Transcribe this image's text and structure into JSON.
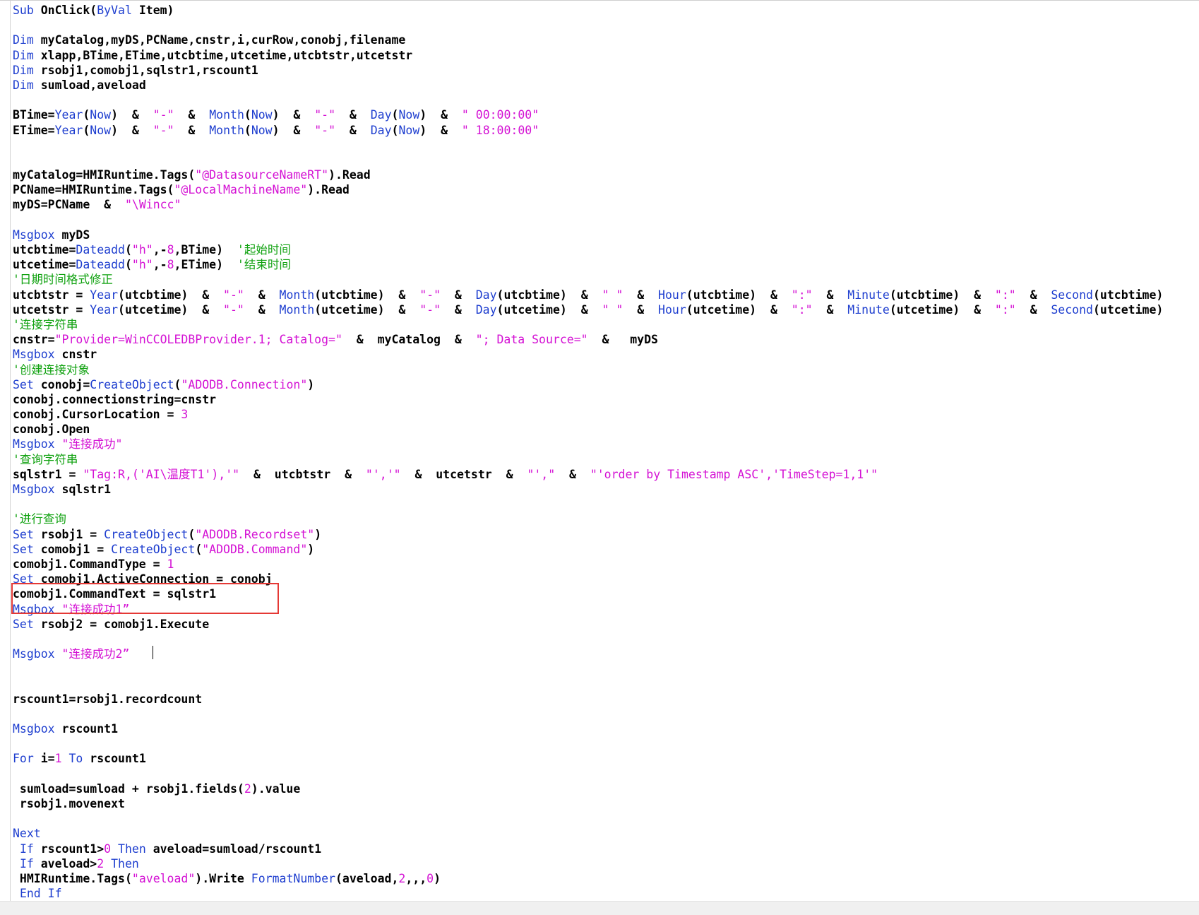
{
  "editor": {
    "lines": [
      [
        [
          "kw",
          "Sub"
        ],
        [
          "p",
          " OnClick("
        ],
        [
          "kw",
          "ByVal"
        ],
        [
          "p",
          " Item)"
        ]
      ],
      [],
      [
        [
          "kw",
          "Dim"
        ],
        [
          "p",
          " myCatalog,myDS,PCName,cnstr,i,curRow,conobj,filename"
        ]
      ],
      [
        [
          "kw",
          "Dim"
        ],
        [
          "p",
          " xlapp,BTime,ETime,utcbtime,utcetime,utcbtstr,utcetstr"
        ]
      ],
      [
        [
          "kw",
          "Dim"
        ],
        [
          "p",
          " rsobj1,comobj1,sqlstr1,rscount1"
        ]
      ],
      [
        [
          "kw",
          "Dim"
        ],
        [
          "p",
          " sumload,aveload"
        ]
      ],
      [],
      [
        [
          "p",
          "BTime="
        ],
        [
          "fn",
          "Year"
        ],
        [
          "p",
          "("
        ],
        [
          "fn",
          "Now"
        ],
        [
          "p",
          ")  &  "
        ],
        [
          "str",
          "\"-\""
        ],
        [
          "p",
          "  &  "
        ],
        [
          "fn",
          "Month"
        ],
        [
          "p",
          "("
        ],
        [
          "fn",
          "Now"
        ],
        [
          "p",
          ")  &  "
        ],
        [
          "str",
          "\"-\""
        ],
        [
          "p",
          "  &  "
        ],
        [
          "fn",
          "Day"
        ],
        [
          "p",
          "("
        ],
        [
          "fn",
          "Now"
        ],
        [
          "p",
          ")  &  "
        ],
        [
          "str",
          "\" 00:00:00\""
        ]
      ],
      [
        [
          "p",
          "ETime="
        ],
        [
          "fn",
          "Year"
        ],
        [
          "p",
          "("
        ],
        [
          "fn",
          "Now"
        ],
        [
          "p",
          ")  &  "
        ],
        [
          "str",
          "\"-\""
        ],
        [
          "p",
          "  &  "
        ],
        [
          "fn",
          "Month"
        ],
        [
          "p",
          "("
        ],
        [
          "fn",
          "Now"
        ],
        [
          "p",
          ")  &  "
        ],
        [
          "str",
          "\"-\""
        ],
        [
          "p",
          "  &  "
        ],
        [
          "fn",
          "Day"
        ],
        [
          "p",
          "("
        ],
        [
          "fn",
          "Now"
        ],
        [
          "p",
          ")  &  "
        ],
        [
          "str",
          "\" 18:00:00\""
        ]
      ],
      [],
      [],
      [
        [
          "p",
          "myCatalog=HMIRuntime.Tags("
        ],
        [
          "str",
          "\"@DatasourceNameRT\""
        ],
        [
          "p",
          ").Read"
        ]
      ],
      [
        [
          "p",
          "PCName=HMIRuntime.Tags("
        ],
        [
          "str",
          "\"@LocalMachineName\""
        ],
        [
          "p",
          ").Read"
        ]
      ],
      [
        [
          "p",
          "myDS=PCName  &  "
        ],
        [
          "str",
          "\"\\Wincc\""
        ]
      ],
      [],
      [
        [
          "kw",
          "Msgbox"
        ],
        [
          "p",
          " myDS"
        ]
      ],
      [
        [
          "p",
          "utcbtime="
        ],
        [
          "fn",
          "Dateadd"
        ],
        [
          "p",
          "("
        ],
        [
          "str",
          "\"h\""
        ],
        [
          "p",
          ",-"
        ],
        [
          "num",
          "8"
        ],
        [
          "p",
          ",BTime)  "
        ],
        [
          "cmt",
          "'起始时间"
        ]
      ],
      [
        [
          "p",
          "utcetime="
        ],
        [
          "fn",
          "Dateadd"
        ],
        [
          "p",
          "("
        ],
        [
          "str",
          "\"h\""
        ],
        [
          "p",
          ",-"
        ],
        [
          "num",
          "8"
        ],
        [
          "p",
          ",ETime)  "
        ],
        [
          "cmt",
          "'结束时间"
        ]
      ],
      [
        [
          "cmt",
          "'日期时间格式修正"
        ]
      ],
      [
        [
          "p",
          "utcbtstr = "
        ],
        [
          "fn",
          "Year"
        ],
        [
          "p",
          "(utcbtime)  &  "
        ],
        [
          "str",
          "\"-\""
        ],
        [
          "p",
          "  &  "
        ],
        [
          "fn",
          "Month"
        ],
        [
          "p",
          "(utcbtime)  &  "
        ],
        [
          "str",
          "\"-\""
        ],
        [
          "p",
          "  &  "
        ],
        [
          "fn",
          "Day"
        ],
        [
          "p",
          "(utcbtime)  &  "
        ],
        [
          "str",
          "\" \""
        ],
        [
          "p",
          "  &  "
        ],
        [
          "fn",
          "Hour"
        ],
        [
          "p",
          "(utcbtime)  &  "
        ],
        [
          "str",
          "\":\""
        ],
        [
          "p",
          "  &  "
        ],
        [
          "fn",
          "Minute"
        ],
        [
          "p",
          "(utcbtime)  &  "
        ],
        [
          "str",
          "\":\""
        ],
        [
          "p",
          "  &  "
        ],
        [
          "fn",
          "Second"
        ],
        [
          "p",
          "(utcbtime)"
        ]
      ],
      [
        [
          "p",
          "utcetstr = "
        ],
        [
          "fn",
          "Year"
        ],
        [
          "p",
          "(utcetime)  &  "
        ],
        [
          "str",
          "\"-\""
        ],
        [
          "p",
          "  &  "
        ],
        [
          "fn",
          "Month"
        ],
        [
          "p",
          "(utcetime)  &  "
        ],
        [
          "str",
          "\"-\""
        ],
        [
          "p",
          "  &  "
        ],
        [
          "fn",
          "Day"
        ],
        [
          "p",
          "(utcetime)  &  "
        ],
        [
          "str",
          "\" \""
        ],
        [
          "p",
          "  &  "
        ],
        [
          "fn",
          "Hour"
        ],
        [
          "p",
          "(utcetime)  &  "
        ],
        [
          "str",
          "\":\""
        ],
        [
          "p",
          "  &  "
        ],
        [
          "fn",
          "Minute"
        ],
        [
          "p",
          "(utcetime)  &  "
        ],
        [
          "str",
          "\":\""
        ],
        [
          "p",
          "  &  "
        ],
        [
          "fn",
          "Second"
        ],
        [
          "p",
          "(utcetime)"
        ]
      ],
      [
        [
          "cmt",
          "'连接字符串"
        ]
      ],
      [
        [
          "p",
          "cnstr="
        ],
        [
          "str",
          "\"Provider=WinCCOLEDBProvider.1; Catalog=\""
        ],
        [
          "p",
          "  &  myCatalog  &  "
        ],
        [
          "str",
          "\"; Data Source=\""
        ],
        [
          "p",
          "  &   myDS"
        ]
      ],
      [
        [
          "kw",
          "Msgbox"
        ],
        [
          "p",
          " cnstr"
        ]
      ],
      [
        [
          "cmt",
          "'创建连接对象"
        ]
      ],
      [
        [
          "kw",
          "Set"
        ],
        [
          "p",
          " conobj="
        ],
        [
          "fn",
          "CreateObject"
        ],
        [
          "p",
          "("
        ],
        [
          "str",
          "\"ADODB.Connection\""
        ],
        [
          "p",
          ")"
        ]
      ],
      [
        [
          "p",
          "conobj.connectionstring=cnstr"
        ]
      ],
      [
        [
          "p",
          "conobj.CursorLocation = "
        ],
        [
          "num",
          "3"
        ]
      ],
      [
        [
          "p",
          "conobj.Open"
        ]
      ],
      [
        [
          "kw",
          "Msgbox"
        ],
        [
          "p",
          " "
        ],
        [
          "str",
          "\"连接成功\""
        ]
      ],
      [
        [
          "cmt",
          "'查询字符串"
        ]
      ],
      [
        [
          "p",
          "sqlstr1 = "
        ],
        [
          "str",
          "\"Tag:R,('AI\\温度T1'),'\""
        ],
        [
          "p",
          "  &  utcbtstr  &  "
        ],
        [
          "str",
          "\"','\""
        ],
        [
          "p",
          "  &  utcetstr  &  "
        ],
        [
          "str",
          "\"',\""
        ],
        [
          "p",
          "  &  "
        ],
        [
          "str",
          "\"'order by Timestamp ASC','TimeStep=1,1'\""
        ]
      ],
      [
        [
          "kw",
          "Msgbox"
        ],
        [
          "p",
          " sqlstr1"
        ]
      ],
      [],
      [
        [
          "cmt",
          "'进行查询"
        ]
      ],
      [
        [
          "kw",
          "Set"
        ],
        [
          "p",
          " rsobj1 = "
        ],
        [
          "fn",
          "CreateObject"
        ],
        [
          "p",
          "("
        ],
        [
          "str",
          "\"ADODB.Recordset\""
        ],
        [
          "p",
          ")"
        ]
      ],
      [
        [
          "kw",
          "Set"
        ],
        [
          "p",
          " comobj1 = "
        ],
        [
          "fn",
          "CreateObject"
        ],
        [
          "p",
          "("
        ],
        [
          "str",
          "\"ADODB.Command\""
        ],
        [
          "p",
          ")"
        ]
      ],
      [
        [
          "p",
          "comobj1.CommandType = "
        ],
        [
          "num",
          "1"
        ]
      ],
      [
        [
          "kw",
          "Set"
        ],
        [
          "p",
          " comobj1.ActiveConnection = conobj"
        ]
      ],
      [
        [
          "p",
          "comobj1.CommandText = sqlstr1"
        ]
      ],
      [
        [
          "kw",
          "Msgbox"
        ],
        [
          "p",
          " "
        ],
        [
          "str",
          "\"连接成功1”"
        ]
      ],
      [
        [
          "kw",
          "Set"
        ],
        [
          "p",
          " rsobj2 = comobj1.Execute"
        ]
      ],
      [],
      [
        [
          "kw",
          "Msgbox"
        ],
        [
          "p",
          " "
        ],
        [
          "str",
          "\"连接成功2”"
        ]
      ],
      [],
      [],
      [
        [
          "p",
          "rscount1=rsobj1.recordcount"
        ]
      ],
      [],
      [
        [
          "kw",
          "Msgbox"
        ],
        [
          "p",
          " rscount1"
        ]
      ],
      [],
      [
        [
          "kw",
          "For"
        ],
        [
          "p",
          " i="
        ],
        [
          "num",
          "1"
        ],
        [
          "p",
          " "
        ],
        [
          "kw",
          "To"
        ],
        [
          "p",
          " rscount1"
        ]
      ],
      [],
      [
        [
          "p",
          " sumload=sumload + rsobj1.fields("
        ],
        [
          "num",
          "2"
        ],
        [
          "p",
          ").value"
        ]
      ],
      [
        [
          "p",
          " rsobj1.movenext"
        ]
      ],
      [],
      [
        [
          "kw",
          "Next"
        ]
      ],
      [
        [
          "p",
          " "
        ],
        [
          "kw",
          "If"
        ],
        [
          "p",
          " rscount1>"
        ],
        [
          "num",
          "0"
        ],
        [
          "p",
          " "
        ],
        [
          "kw",
          "Then"
        ],
        [
          "p",
          " aveload=sumload/rscount1"
        ]
      ],
      [
        [
          "p",
          " "
        ],
        [
          "kw",
          "If"
        ],
        [
          "p",
          " aveload>"
        ],
        [
          "num",
          "2"
        ],
        [
          "p",
          " "
        ],
        [
          "kw",
          "Then"
        ]
      ],
      [
        [
          "p",
          " HMIRuntime.Tags("
        ],
        [
          "str",
          "\"aveload\""
        ],
        [
          "p",
          ").Write "
        ],
        [
          "fn",
          "FormatNumber"
        ],
        [
          "p",
          "(aveload,"
        ],
        [
          "num",
          "2"
        ],
        [
          "p",
          ",,,"
        ],
        [
          "num",
          "0"
        ],
        [
          "p",
          ")"
        ]
      ],
      [
        [
          "p",
          " "
        ],
        [
          "kw",
          "End If"
        ]
      ]
    ]
  },
  "colors": {
    "keyword": "#1e3ecf",
    "string": "#d412d4",
    "number": "#d412d4",
    "comment": "#11a211",
    "plain": "#000000",
    "highlight_box": "#e53935"
  }
}
